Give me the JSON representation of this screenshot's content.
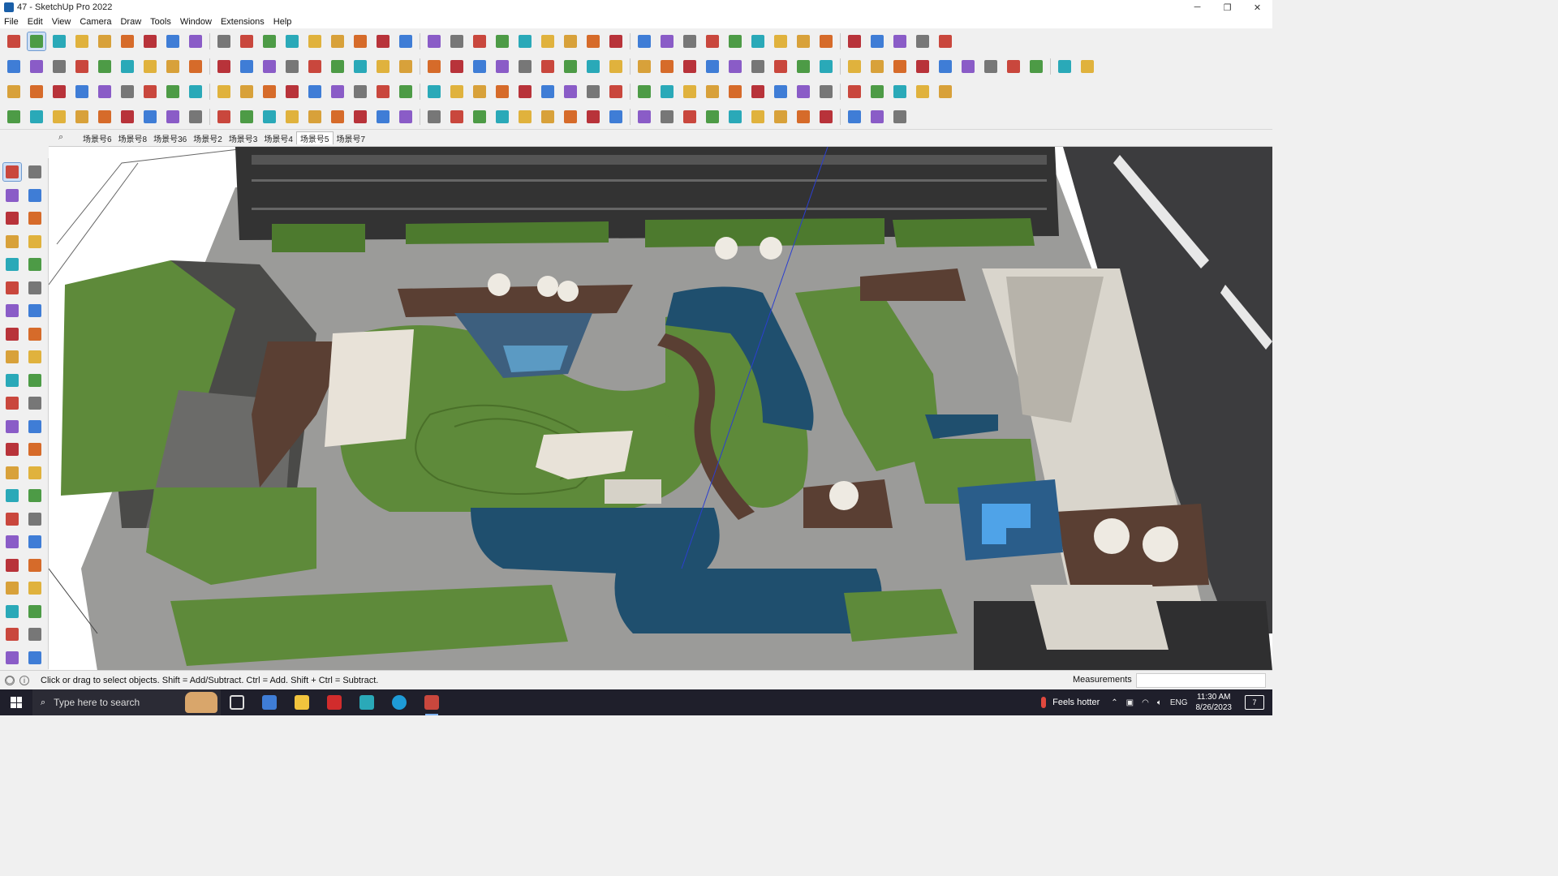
{
  "window": {
    "title": "47 - SketchUp Pro 2022",
    "minimize_glyph": "─",
    "maximize_glyph": "❐",
    "close_glyph": "✕"
  },
  "menu": [
    "File",
    "Edit",
    "View",
    "Camera",
    "Draw",
    "Tools",
    "Window",
    "Extensions",
    "Help"
  ],
  "scenes": {
    "tabs": [
      "场景号6",
      "场景号8",
      "场景号36",
      "场景号2",
      "场景号3",
      "场景号4",
      "场景号5",
      "场景号7"
    ],
    "active": "场景号5"
  },
  "statusbar": {
    "hint": "Click or drag to select objects. Shift = Add/Subtract. Ctrl = Add. Shift + Ctrl = Subtract.",
    "measurements_label": "Measurements",
    "measurements_value": ""
  },
  "taskbar": {
    "search_placeholder": "Type here to search",
    "weather": "Feels hotter",
    "language": "ENG",
    "time": "11:30 AM",
    "date": "8/26/2023",
    "notification_count": "7"
  },
  "colors": {
    "grass": "#5e8a3a",
    "paving": "#9a9a98",
    "water": "#1f4f6e",
    "deck": "#5a3f33",
    "roof": "#d6d2c8",
    "building": "#3a3a3a",
    "taskbar": "#1f1f2b"
  }
}
